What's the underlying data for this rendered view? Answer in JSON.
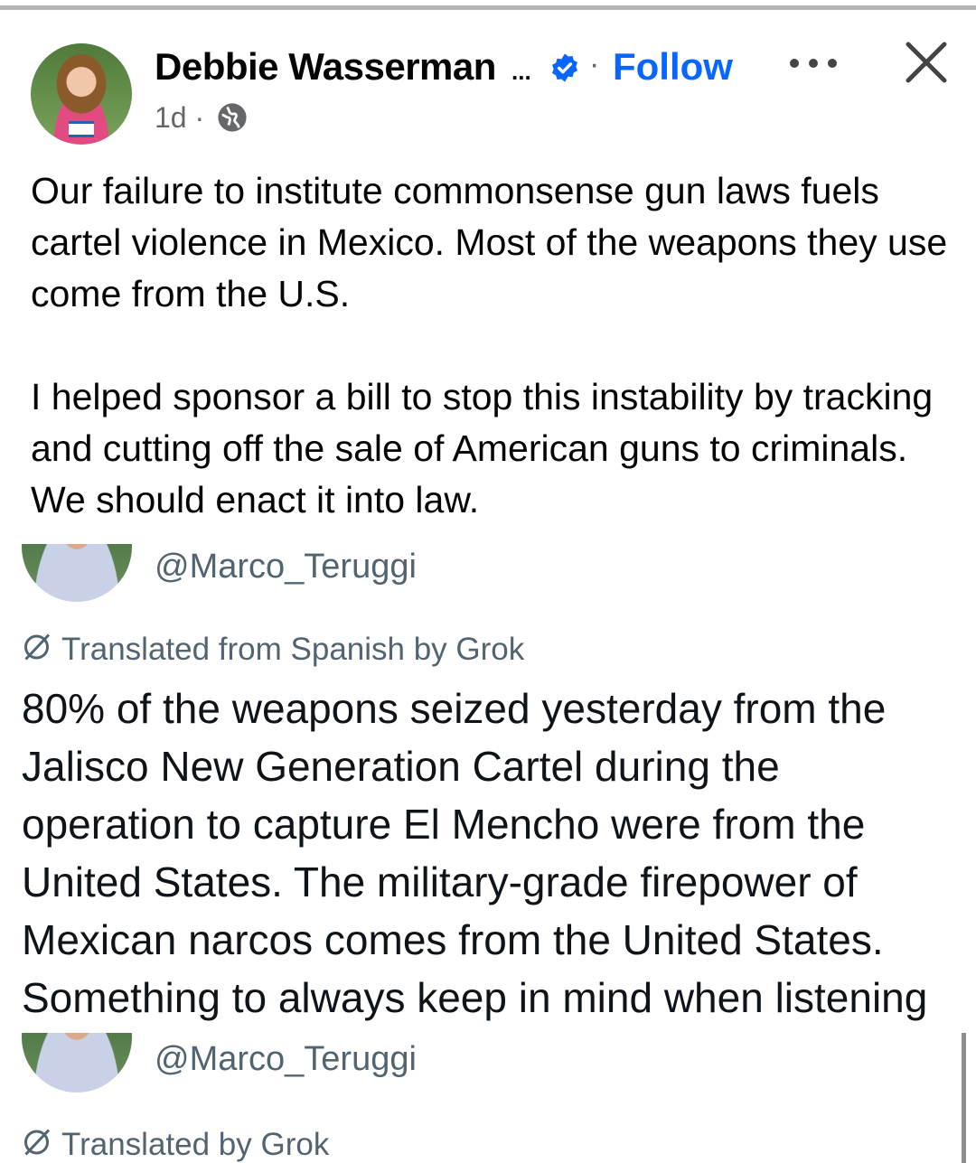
{
  "post": {
    "author": "Debbie Wasserman",
    "author_truncation": "...",
    "separator": "·",
    "follow_label": "Follow",
    "timestamp": "1d ·",
    "paragraphs": [
      "Our failure to institute commonsense gun laws fuels cartel violence in Mexico. Most of the weapons they use come from the U.S.",
      "I helped sponsor a bill to stop this instability by tracking and cutting off the sale of American guns to criminals. We should enact it into law."
    ]
  },
  "embeds": [
    {
      "handle": "@Marco_Teruggi",
      "translation_note": "Translated from Spanish by Grok",
      "text": "80% of the weapons seized yesterday from the Jalisco New Generation Cartel during the operation to capture El Mencho were from the United States. The military-grade firepower of Mexican narcos comes from the United States. Something to always keep in mind when listening"
    },
    {
      "handle": "@Marco_Teruggi",
      "translation_note": "Translated by Grok"
    }
  ],
  "colors": {
    "link_blue": "#0866ff",
    "secondary_text": "#65676b",
    "handle_gray": "#536471"
  },
  "icons": [
    "verified-badge-icon",
    "more-options-icon",
    "close-icon",
    "globe-icon",
    "grok-icon"
  ]
}
